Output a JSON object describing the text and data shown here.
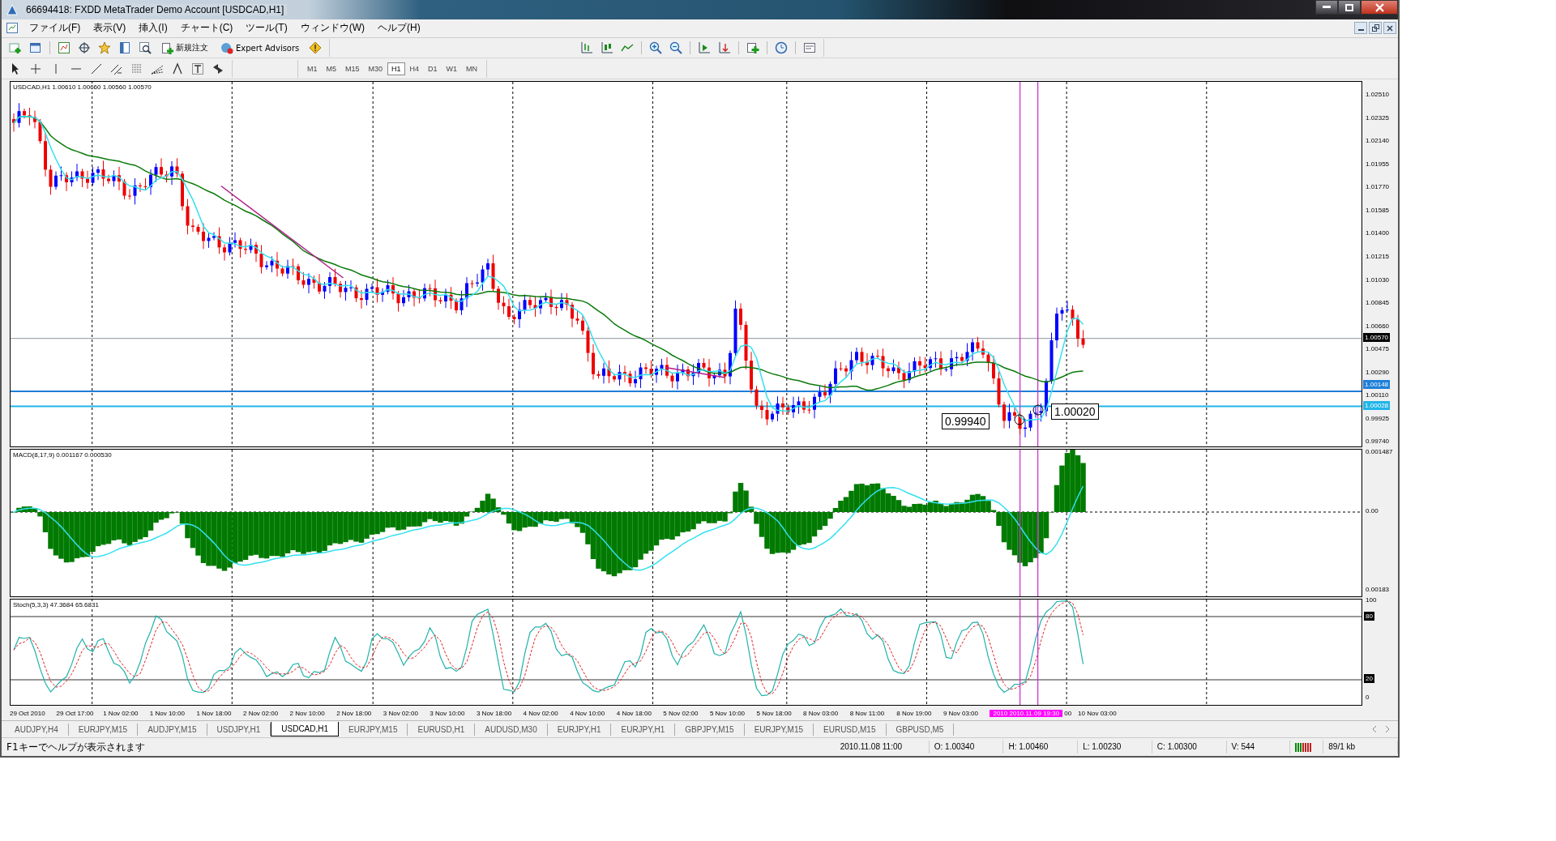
{
  "window": {
    "title": "66694418: FXDD  MetaTrader  Demo Account  [USDCAD,H1]"
  },
  "menu": [
    "ファイル(F)",
    "表示(V)",
    "挿入(I)",
    "チャート(C)",
    "ツール(T)",
    "ウィンドウ(W)",
    "ヘルプ(H)"
  ],
  "toolbar": {
    "new_order": "新規注文",
    "expert_advisors": "Expert Advisors"
  },
  "timeframes": [
    {
      "label": "M1",
      "selected": false
    },
    {
      "label": "M5",
      "selected": false
    },
    {
      "label": "M15",
      "selected": false
    },
    {
      "label": "M30",
      "selected": false
    },
    {
      "label": "H1",
      "selected": true
    },
    {
      "label": "H4",
      "selected": false
    },
    {
      "label": "D1",
      "selected": false
    },
    {
      "label": "W1",
      "selected": false
    },
    {
      "label": "MN",
      "selected": false
    }
  ],
  "price_chart": {
    "header": "USDCAD,H1  1.00610 1.00660 1.00560 1.00570",
    "axis_labels": [
      "1.02510",
      "1.02325",
      "1.02140",
      "1.01955",
      "1.01770",
      "1.01585",
      "1.01400",
      "1.01215",
      "1.01030",
      "1.00845",
      "1.00660",
      "1.00475",
      "1.00290",
      "1.00110",
      "0.99925",
      "0.99740"
    ],
    "marker_labels": [
      {
        "text": "1.00570",
        "color": "#000000"
      },
      {
        "text": "1.00148",
        "color": "#1e7fd8"
      },
      {
        "text": "1.00028",
        "color": "#21b5e8"
      }
    ],
    "callouts": [
      "0.99940",
      "1.00020"
    ]
  },
  "macd": {
    "header": "MACD(8,17,9) 0.001167 0.000530",
    "axis_labels": [
      "0.001487",
      "0.00",
      "0.00183"
    ]
  },
  "stochastic": {
    "header": "Stoch(5,3,3) 47.3684 65.6831",
    "axis_labels": [
      "100",
      "80",
      "20",
      "0"
    ]
  },
  "time_axis": {
    "labels": [
      "29 Oct 2010",
      "29 Oct 17:00",
      "1 Nov 02:00",
      "1 Nov 10:00",
      "1 Nov 18:00",
      "2 Nov 02:00",
      "2 Nov 10:00",
      "2 Nov 18:00",
      "3 Nov 02:00",
      "3 Nov 10:00",
      "3 Nov 18:00",
      "4 Nov 02:00",
      "4 Nov 10:00",
      "4 Nov 18:00",
      "5 Nov 02:00",
      "5 Nov 10:00",
      "5 Nov 18:00",
      "8 Nov 03:00",
      "8 Nov 11:00",
      "8 Nov 19:00",
      "9 Nov 03:00"
    ],
    "cursor_label": "2010 2010.11.09 19:30",
    "partial_label": "00",
    "last_label": "10 Nov 03:00"
  },
  "tabs": [
    {
      "label": "AUDJPY,H4",
      "selected": false
    },
    {
      "label": "EURJPY,M15",
      "selected": false
    },
    {
      "label": "AUDJPY,M15",
      "selected": false
    },
    {
      "label": "USDJPY,H1",
      "selected": false
    },
    {
      "label": "USDCAD,H1",
      "selected": true
    },
    {
      "label": "EURJPY,M15",
      "selected": false
    },
    {
      "label": "EURUSD,H1",
      "selected": false
    },
    {
      "label": "AUDUSD,M30",
      "selected": false
    },
    {
      "label": "EURJPY,H1",
      "selected": false
    },
    {
      "label": "EURJPY,H1",
      "selected": false
    },
    {
      "label": "GBPJPY,M15",
      "selected": false
    },
    {
      "label": "EURJPY,M15",
      "selected": false
    },
    {
      "label": "EURUSD,M15",
      "selected": false
    },
    {
      "label": "GBPUSD,M5",
      "selected": false
    }
  ],
  "status_bar": {
    "help": "F1キーでヘルプが表示されます",
    "time": "2010.11.08 11:00",
    "open": "O: 1.00340",
    "high": "H: 1.00460",
    "low": "L: 1.00230",
    "close": "C: 1.00300",
    "volume": "V: 544",
    "traffic": "89/1 kb"
  }
}
